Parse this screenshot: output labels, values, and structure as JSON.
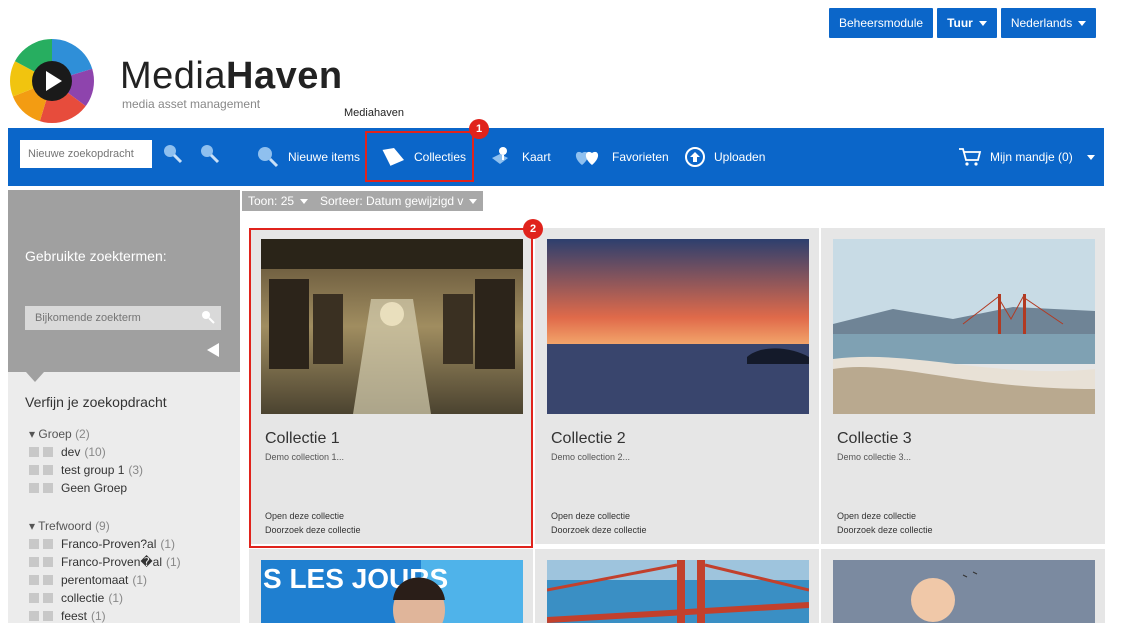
{
  "top_buttons": {
    "admin": "Beheersmodule",
    "user": "Tuur",
    "language": "Nederlands"
  },
  "brand": {
    "name_light": "Media",
    "name_bold": "Haven",
    "tagline": "media asset management",
    "tooltip": "Mediahaven"
  },
  "navbar": {
    "search_placeholder": "Nieuwe zoekopdracht",
    "items": [
      {
        "label": "Nieuwe items",
        "icon": "search-icon"
      },
      {
        "label": "Collecties",
        "icon": "collection-icon"
      },
      {
        "label": "Kaart",
        "icon": "map-pin-icon"
      },
      {
        "label": "Favorieten",
        "icon": "hearts-icon"
      },
      {
        "label": "Uploaden",
        "icon": "upload-icon"
      }
    ],
    "cart": "Mijn mandje (0)"
  },
  "annotations": {
    "badge_1": "1",
    "badge_2": "2"
  },
  "sidebar": {
    "used_terms_title": "Gebruikte zoektermen:",
    "extra_term_placeholder": "Bijkomende zoekterm",
    "refine_title": "Verfijn je zoekopdracht",
    "groups": [
      {
        "name": "Groep",
        "count": "(2)",
        "items": [
          {
            "label": "dev",
            "count": "(10)"
          },
          {
            "label": "test group 1",
            "count": "(3)"
          },
          {
            "label": "Geen Groep",
            "count": ""
          }
        ]
      },
      {
        "name": "Trefwoord",
        "count": "(9)",
        "items": [
          {
            "label": "Franco-Proven?al",
            "count": "(1)"
          },
          {
            "label": "Franco-Proven�al",
            "count": "(1)"
          },
          {
            "label": "perentomaat",
            "count": "(1)"
          },
          {
            "label": "collectie",
            "count": "(1)"
          },
          {
            "label": "feest",
            "count": "(1)"
          }
        ]
      }
    ]
  },
  "toolbar": {
    "show": "Toon: 25",
    "sort": "Sorteer: Datum gewijzigd v"
  },
  "collections": [
    {
      "title": "Collectie 1",
      "desc": "Demo collection 1...",
      "open": "Open deze collectie",
      "browse": "Doorzoek deze collectie"
    },
    {
      "title": "Collectie 2",
      "desc": "Demo collection 2...",
      "open": "Open deze collectie",
      "browse": "Doorzoek deze collectie"
    },
    {
      "title": "Collectie 3",
      "desc": "Demo collectie 3...",
      "open": "Open deze collectie",
      "browse": "Doorzoek deze collectie"
    }
  ],
  "second_row_text": "S LES JOURS",
  "colors": {
    "primary": "#0b66c9",
    "highlight": "#e0231c",
    "sidebar": "#a0a0a0"
  }
}
